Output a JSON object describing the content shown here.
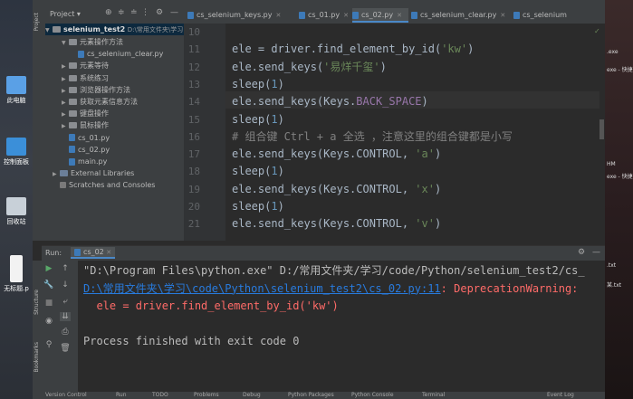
{
  "desktop": {
    "icons": [
      {
        "label": "此电脑"
      },
      {
        "label": "控制面板"
      },
      {
        "label": "回收站"
      },
      {
        "label": "无标题.p"
      }
    ],
    "right_texts": [
      ".exe",
      "exe - 快捷",
      "HM",
      "exe - 快捷",
      ".txt",
      "某.txt"
    ]
  },
  "project_panel": {
    "title": "Project",
    "root": "selenium_test2",
    "root_path": "D:\\常用文件夹\\学习",
    "items": [
      {
        "label": "元素操作方法",
        "type": "folder",
        "indent": 1,
        "open": true
      },
      {
        "label": "cs_selenium_clear.py",
        "type": "py",
        "indent": 2
      },
      {
        "label": "元素等待",
        "type": "folder",
        "indent": 1
      },
      {
        "label": "系统练习",
        "type": "folder",
        "indent": 1
      },
      {
        "label": "浏览器操作方法",
        "type": "folder",
        "indent": 1
      },
      {
        "label": "获取元素信息方法",
        "type": "folder",
        "indent": 1
      },
      {
        "label": "键盘操作",
        "type": "folder",
        "indent": 1
      },
      {
        "label": "鼠标操作",
        "type": "folder",
        "indent": 1
      },
      {
        "label": "cs_01.py",
        "type": "py",
        "indent": 1
      },
      {
        "label": "cs_02.py",
        "type": "py",
        "indent": 1
      },
      {
        "label": "main.py",
        "type": "py",
        "indent": 1
      },
      {
        "label": "External Libraries",
        "type": "lib",
        "indent": 0
      },
      {
        "label": "Scratches and Consoles",
        "type": "scratch",
        "indent": 0
      }
    ]
  },
  "tabs": [
    {
      "label": "cs_selenium_keys.py",
      "active": false
    },
    {
      "label": "cs_01.py",
      "active": false
    },
    {
      "label": "cs_02.py",
      "active": true
    },
    {
      "label": "cs_selenium_clear.py",
      "active": false
    },
    {
      "label": "cs_selenium",
      "active": false
    }
  ],
  "editor": {
    "lines": [
      {
        "n": "10",
        "parts": []
      },
      {
        "n": "11",
        "parts": [
          {
            "t": "ele = driver.find_element_by_id(",
            "c": ""
          },
          {
            "t": "'kw'",
            "c": "str"
          },
          {
            "t": ")",
            "c": ""
          }
        ]
      },
      {
        "n": "12",
        "parts": [
          {
            "t": "ele.send_keys(",
            "c": ""
          },
          {
            "t": "'易烊千玺'",
            "c": "str"
          },
          {
            "t": ")",
            "c": ""
          }
        ]
      },
      {
        "n": "13",
        "parts": [
          {
            "t": "sleep(",
            "c": ""
          },
          {
            "t": "1",
            "c": "num"
          },
          {
            "t": ")",
            "c": ""
          }
        ]
      },
      {
        "n": "14",
        "parts": [
          {
            "t": "ele.send_keys(Keys.",
            "c": ""
          },
          {
            "t": "BACK_SPACE",
            "c": "cst"
          },
          {
            "t": ")",
            "c": ""
          }
        ]
      },
      {
        "n": "15",
        "parts": [
          {
            "t": "sleep(",
            "c": ""
          },
          {
            "t": "1",
            "c": "num"
          },
          {
            "t": ")",
            "c": ""
          }
        ]
      },
      {
        "n": "16",
        "parts": [
          {
            "t": "# 组合键 Ctrl + a 全选 ，注意这里的组合键都是小写",
            "c": "cmt"
          }
        ]
      },
      {
        "n": "17",
        "parts": [
          {
            "t": "ele.send_keys(Keys.CONTROL, ",
            "c": ""
          },
          {
            "t": "'a'",
            "c": "str"
          },
          {
            "t": ")",
            "c": ""
          }
        ]
      },
      {
        "n": "18",
        "parts": [
          {
            "t": "sleep(",
            "c": ""
          },
          {
            "t": "1",
            "c": "num"
          },
          {
            "t": ")",
            "c": ""
          }
        ]
      },
      {
        "n": "19",
        "parts": [
          {
            "t": "ele.send_keys(Keys.CONTROL, ",
            "c": ""
          },
          {
            "t": "'x'",
            "c": "str"
          },
          {
            "t": ")",
            "c": ""
          }
        ]
      },
      {
        "n": "20",
        "parts": [
          {
            "t": "sleep(",
            "c": ""
          },
          {
            "t": "1",
            "c": "num"
          },
          {
            "t": ")",
            "c": ""
          }
        ]
      },
      {
        "n": "21",
        "parts": [
          {
            "t": "ele.send_keys(Keys.CONTROL, ",
            "c": ""
          },
          {
            "t": "'v'",
            "c": "str"
          },
          {
            "t": ")",
            "c": ""
          }
        ]
      }
    ]
  },
  "run": {
    "label": "Run:",
    "config": "cs_02",
    "lines": [
      {
        "text": "\"D:\\Program Files\\python.exe\" D:/常用文件夹/学习/code/Python/selenium_test2/cs_",
        "color": "#bbbbbb"
      },
      {
        "text": "D:\\常用文件夹\\学习\\code\\Python\\selenium_test2\\cs_02.py:11",
        "color": "#287bde",
        "suffix": ": DeprecationWarning:",
        "suffix_color": "#ff6b68"
      },
      {
        "text": "  ele = driver.find_element_by_id('kw')",
        "color": "#ff6b68"
      },
      {
        "text": "",
        "color": "#bbbbbb"
      },
      {
        "text": "Process finished with exit code 0",
        "color": "#bbbbbb"
      }
    ]
  },
  "statusbar": {
    "items": [
      "Version Control",
      "Run",
      "TODO",
      "Problems",
      "Debug",
      "Python Packages",
      "Python Console",
      "Terminal",
      "Event Log"
    ]
  },
  "side_labels": {
    "project": "Project",
    "structure": "Structure",
    "bookmarks": "Bookmarks"
  },
  "colors": {
    "accent": "#4a88c7",
    "string": "#6a8759",
    "number": "#6897bb",
    "link": "#287bde",
    "error": "#ff6b68"
  }
}
